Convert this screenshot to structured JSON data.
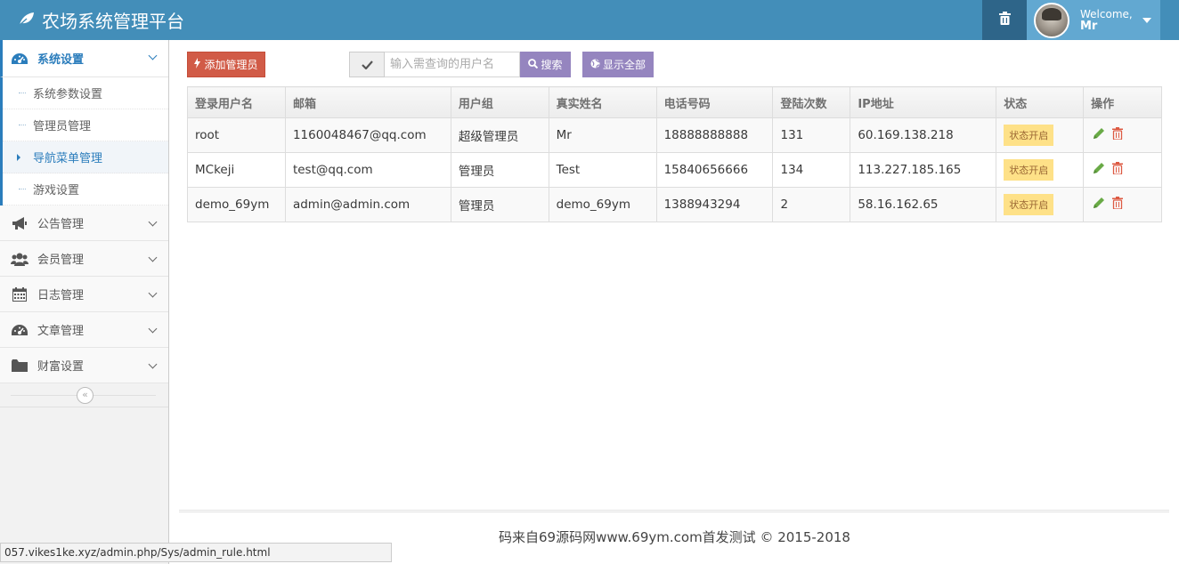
{
  "brand": {
    "title": "农场系统管理平台"
  },
  "user": {
    "welcome": "Welcome,",
    "name": "Mr"
  },
  "sidebar": {
    "active": {
      "label": "系统设置"
    },
    "submenu": [
      {
        "label": "系统参数设置"
      },
      {
        "label": "管理员管理"
      },
      {
        "label": "导航菜单管理"
      },
      {
        "label": "游戏设置"
      }
    ],
    "items": [
      {
        "label": "公告管理"
      },
      {
        "label": "会员管理"
      },
      {
        "label": "日志管理"
      },
      {
        "label": "文章管理"
      },
      {
        "label": "财富设置"
      }
    ],
    "collapse_symbol": "«"
  },
  "toolbar": {
    "add_label": "添加管理员",
    "search_placeholder": "输入需查询的用户名",
    "search_label": "搜索",
    "showall_label": "显示全部"
  },
  "table": {
    "headers": [
      "登录用户名",
      "邮箱",
      "用户组",
      "真实姓名",
      "电话号码",
      "登陆次数",
      "IP地址",
      "状态",
      "操作"
    ],
    "rows": [
      {
        "username": "root",
        "email": "1160048467@qq.com",
        "group": "超级管理员",
        "realname": "Mr",
        "phone": "18888888888",
        "logins": "131",
        "ip": "60.169.138.218",
        "status": "状态开启"
      },
      {
        "username": "MCkeji",
        "email": "test@qq.com",
        "group": "管理员",
        "realname": "Test",
        "phone": "15840656666",
        "logins": "134",
        "ip": "113.227.185.165",
        "status": "状态开启"
      },
      {
        "username": "demo_69ym",
        "email": "admin@admin.com",
        "group": "管理员",
        "realname": "demo_69ym",
        "phone": "1388943294",
        "logins": "2",
        "ip": "58.16.162.65",
        "status": "状态开启"
      }
    ]
  },
  "footer": {
    "text": "码来自69源码网www.69ym.com首发测试 © 2015-2018"
  },
  "statusbar": {
    "url": "057.vikes1ke.xyz/admin.php/Sys/admin_rule.html"
  },
  "colors": {
    "navbar": "#438eb9",
    "accent": "#2b7dbc",
    "danger": "#d15b47",
    "purple": "#9585bf",
    "badge": "#fee188",
    "edit": "#69aa46",
    "delete": "#dd5a43"
  }
}
